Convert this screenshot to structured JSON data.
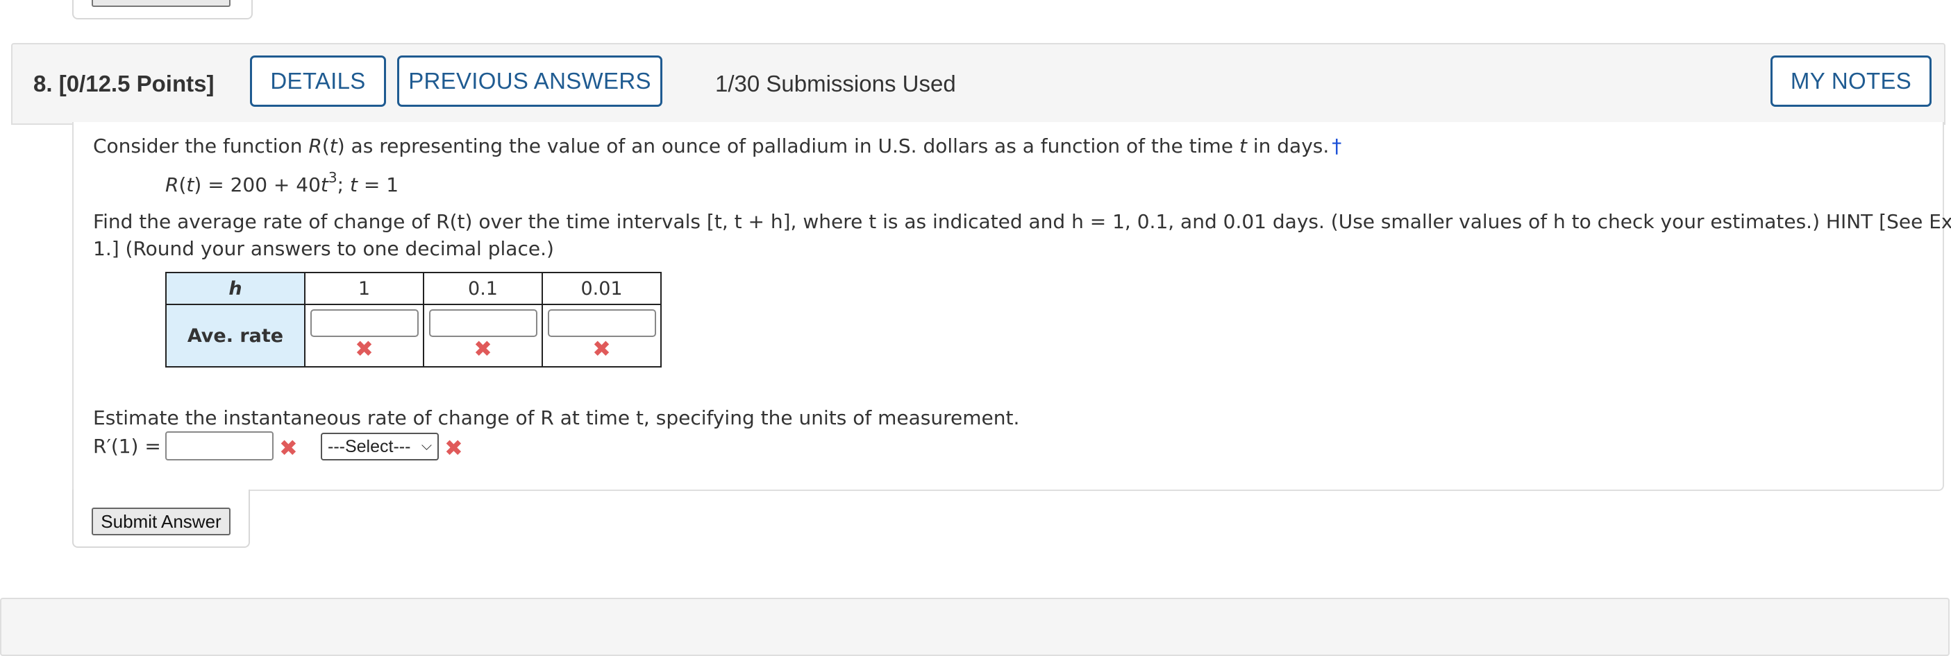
{
  "question": {
    "number": "8.",
    "points": "[0/12.5 Points]",
    "details_label": "DETAILS",
    "previous_answers_label": "PREVIOUS ANSWERS",
    "submissions": "1/30 Submissions Used",
    "my_notes_label": "MY NOTES"
  },
  "body": {
    "intro_a": "Consider the function ",
    "intro_func": "R",
    "intro_b": "(",
    "intro_t": "t",
    "intro_c": ") as representing the value of an ounce of palladium in U.S. dollars as a function of the time ",
    "intro_t2": "t",
    "intro_d": " in days.",
    "dagger": "†",
    "eq_R": "R",
    "eq_open": "(",
    "eq_t": "t",
    "eq_mid": ") = 200 + 40",
    "eq_t3": "t",
    "eq_exp": "3",
    "eq_sep": "; ",
    "eq_t4": "t",
    "eq_end": " = 1",
    "find_line1": "Find the average rate of change of R(t) over the time intervals [t, t + h], where t is as indicated and h = 1, 0.1, and 0.01 days. (Use smaller values of h to check your estimates.) HINT [See Example",
    "find_line2": "1.] (Round your answers to one decimal place.)",
    "estimate_text": "Estimate the instantaneous rate of change of R at time t, specifying the units of measurement.",
    "rprime_label": "R′(1) =",
    "select_value": "---Select---"
  },
  "table": {
    "h_header": "h",
    "row_label": "Ave. rate",
    "columns": [
      "1",
      "0.1",
      "0.01"
    ],
    "values": [
      "",
      "",
      ""
    ],
    "status": [
      "incorrect",
      "incorrect",
      "incorrect"
    ]
  },
  "status_icon": "✖",
  "submit_label": "Submit Answer",
  "colors": {
    "accent": "#1f5b91",
    "header_bg": "#f5f5f5",
    "table_header_bg": "#dbeefa",
    "error": "#e05a5a",
    "dagger": "#1a4fd6"
  }
}
